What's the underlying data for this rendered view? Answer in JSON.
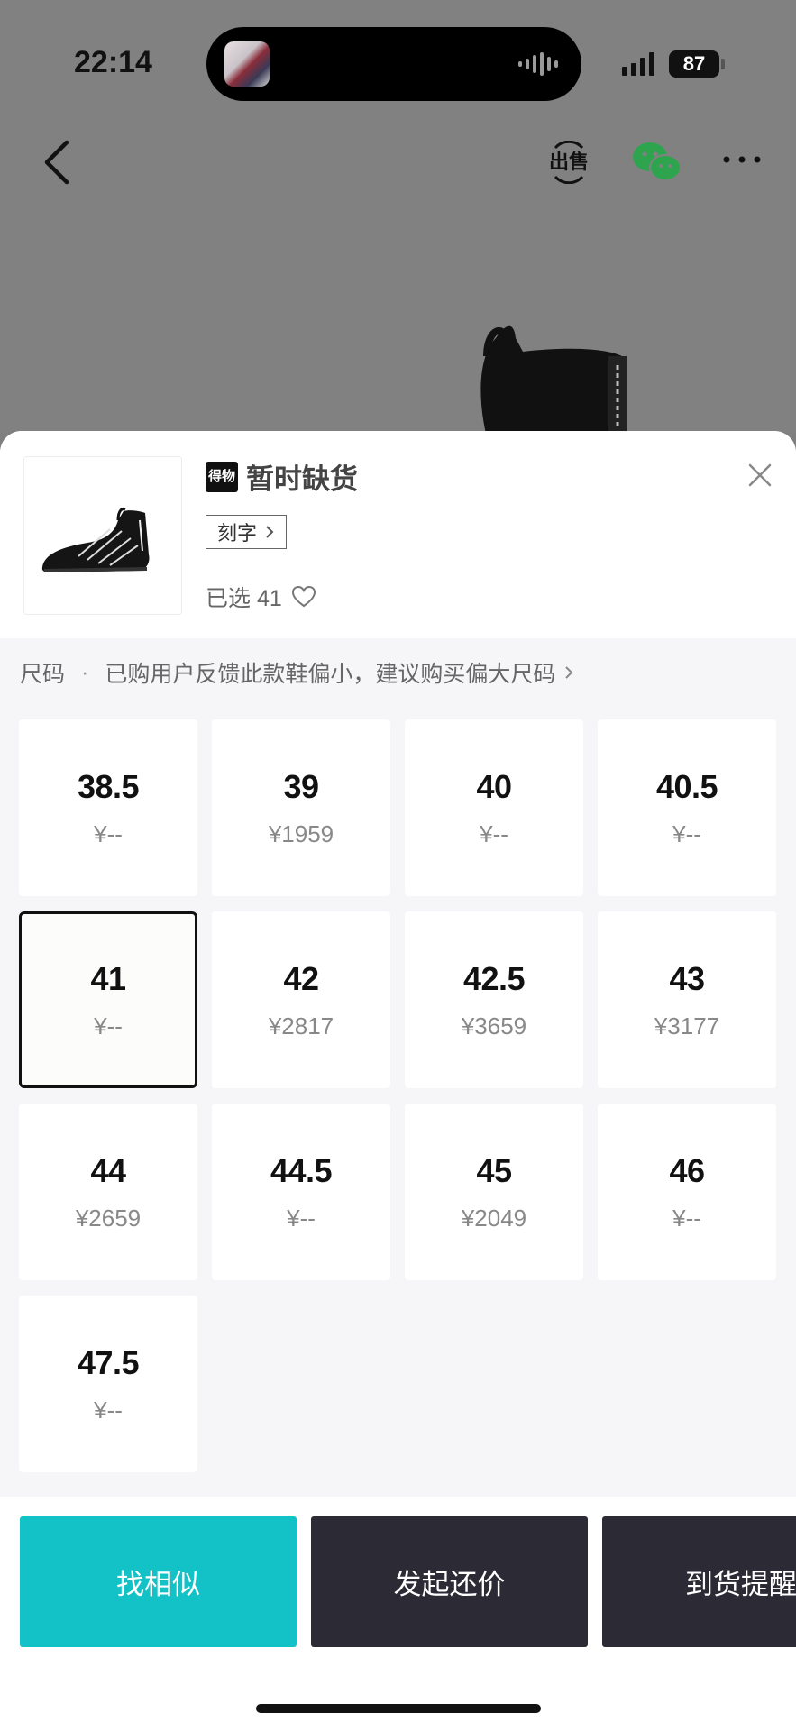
{
  "status_bar": {
    "time": "22:14",
    "battery": "87"
  },
  "nav": {
    "sell_icon": "sell-icon",
    "wechat_icon": "wechat-icon",
    "more_icon": "more-icon"
  },
  "product": {
    "brand_logo": "得物",
    "status": "暂时缺货",
    "engrave_label": "刻字",
    "selected_label": "已选 41"
  },
  "size_section": {
    "label": "尺码",
    "hint": "已购用户反馈此款鞋偏小，建议购买偏大尺码"
  },
  "sizes": [
    {
      "size": "38.5",
      "price": "¥--"
    },
    {
      "size": "39",
      "price": "¥1959"
    },
    {
      "size": "40",
      "price": "¥--"
    },
    {
      "size": "40.5",
      "price": "¥--"
    },
    {
      "size": "41",
      "price": "¥--",
      "selected": true
    },
    {
      "size": "42",
      "price": "¥2817"
    },
    {
      "size": "42.5",
      "price": "¥3659"
    },
    {
      "size": "43",
      "price": "¥3177"
    },
    {
      "size": "44",
      "price": "¥2659"
    },
    {
      "size": "44.5",
      "price": "¥--"
    },
    {
      "size": "45",
      "price": "¥2049"
    },
    {
      "size": "46",
      "price": "¥--"
    },
    {
      "size": "47.5",
      "price": "¥--"
    }
  ],
  "actions": {
    "similar": "找相似",
    "bargain": "发起还价",
    "notify": "到货提醒"
  },
  "colors": {
    "accent": "#12c2c6",
    "dark_button": "#2b2a35",
    "sheet_bg": "#f6f6f9"
  }
}
